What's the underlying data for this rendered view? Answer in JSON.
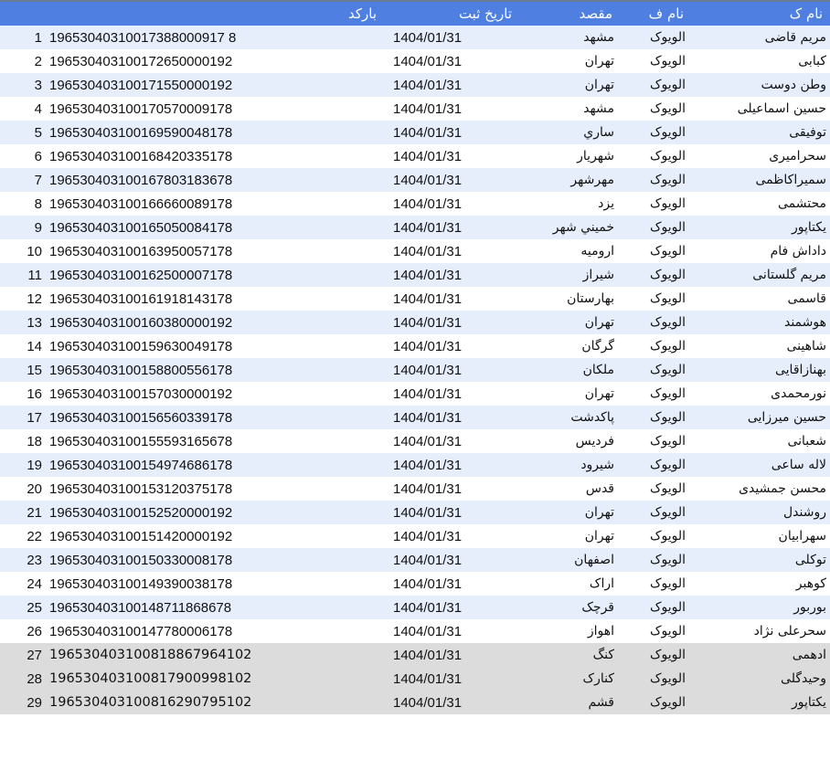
{
  "table": {
    "headers": {
      "name": "نام ک",
      "family": "نام ف",
      "dest": "مقصد",
      "date": "تاریخ ثبت",
      "barcode": "بارکد"
    },
    "rows": [
      {
        "idx": "1",
        "barcode": "19653040310017388000917 8",
        "date": "1404/01/31",
        "dest": "مشهد",
        "family": "الویوک",
        "name": "مریم قاضی"
      },
      {
        "idx": "2",
        "barcode": "196530403100172650000192",
        "date": "1404/01/31",
        "dest": "تهران",
        "family": "الویوک",
        "name": "کبابی"
      },
      {
        "idx": "3",
        "barcode": "196530403100171550000192",
        "date": "1404/01/31",
        "dest": "تهران",
        "family": "الویوک",
        "name": "وطن دوست"
      },
      {
        "idx": "4",
        "barcode": "196530403100170570009178",
        "date": "1404/01/31",
        "dest": "مشهد",
        "family": "الویوک",
        "name": "حسین اسماعیلی"
      },
      {
        "idx": "5",
        "barcode": "196530403100169590048178",
        "date": "1404/01/31",
        "dest": "ساري",
        "family": "الویوک",
        "name": "توفیقی"
      },
      {
        "idx": "6",
        "barcode": "196530403100168420335178",
        "date": "1404/01/31",
        "dest": "شهريار",
        "family": "الویوک",
        "name": "سحرامیری"
      },
      {
        "idx": "7",
        "barcode": "196530403100167803183678",
        "date": "1404/01/31",
        "dest": "مهرشهر",
        "family": "الویوک",
        "name": "سمیراکاظمی"
      },
      {
        "idx": "8",
        "barcode": "196530403100166660089178",
        "date": "1404/01/31",
        "dest": "یزد",
        "family": "الویوک",
        "name": "محتشمی"
      },
      {
        "idx": "9",
        "barcode": "196530403100165050084178",
        "date": "1404/01/31",
        "dest": "خميني شهر",
        "family": "الویوک",
        "name": "یکتاپور"
      },
      {
        "idx": "10",
        "barcode": "196530403100163950057178",
        "date": "1404/01/31",
        "dest": "ارومیه",
        "family": "الویوک",
        "name": "داداش فام"
      },
      {
        "idx": "11",
        "barcode": "196530403100162500007178",
        "date": "1404/01/31",
        "dest": "شیراز",
        "family": "الویوک",
        "name": "مریم گلستانی"
      },
      {
        "idx": "12",
        "barcode": "196530403100161918143178",
        "date": "1404/01/31",
        "dest": "بهارستان",
        "family": "الویوک",
        "name": "قاسمی"
      },
      {
        "idx": "13",
        "barcode": "196530403100160380000192",
        "date": "1404/01/31",
        "dest": "تهران",
        "family": "الویوک",
        "name": "هوشمند"
      },
      {
        "idx": "14",
        "barcode": "196530403100159630049178",
        "date": "1404/01/31",
        "dest": "گرگان",
        "family": "الویوک",
        "name": "شاهینی"
      },
      {
        "idx": "15",
        "barcode": "196530403100158800556178",
        "date": "1404/01/31",
        "dest": "ملکان",
        "family": "الویوک",
        "name": "بهنازاقایی"
      },
      {
        "idx": "16",
        "barcode": "196530403100157030000192",
        "date": "1404/01/31",
        "dest": "تهران",
        "family": "الویوک",
        "name": "نورمحمدی"
      },
      {
        "idx": "17",
        "barcode": "196530403100156560339178",
        "date": "1404/01/31",
        "dest": "پاکدشت",
        "family": "الویوک",
        "name": "حسین میرزایی"
      },
      {
        "idx": "18",
        "barcode": "196530403100155593165678",
        "date": "1404/01/31",
        "dest": "فرديس",
        "family": "الویوک",
        "name": "شعبانی"
      },
      {
        "idx": "19",
        "barcode": "196530403100154974686178",
        "date": "1404/01/31",
        "dest": "شیرود",
        "family": "الویوک",
        "name": "لاله ساعی"
      },
      {
        "idx": "20",
        "barcode": "196530403100153120375178",
        "date": "1404/01/31",
        "dest": "قدس",
        "family": "الویوک",
        "name": "محسن جمشیدی"
      },
      {
        "idx": "21",
        "barcode": "196530403100152520000192",
        "date": "1404/01/31",
        "dest": "تهران",
        "family": "الویوک",
        "name": "روشندل"
      },
      {
        "idx": "22",
        "barcode": "196530403100151420000192",
        "date": "1404/01/31",
        "dest": "تهران",
        "family": "الویوک",
        "name": "سهرابیان"
      },
      {
        "idx": "23",
        "barcode": "196530403100150330008178",
        "date": "1404/01/31",
        "dest": "اصفهان",
        "family": "الویوک",
        "name": "توکلی"
      },
      {
        "idx": "24",
        "barcode": "196530403100149390038178",
        "date": "1404/01/31",
        "dest": "اراک",
        "family": "الویوک",
        "name": "کوهبر"
      },
      {
        "idx": "25",
        "barcode": "196530403100148711868678",
        "date": "1404/01/31",
        "dest": "قرچک",
        "family": "الویوک",
        "name": "بوربور"
      },
      {
        "idx": "26",
        "barcode": "196530403100147780006178",
        "date": "1404/01/31",
        "dest": "اهواز",
        "family": "الویوک",
        "name": "سحرعلی نژاد"
      },
      {
        "idx": "27",
        "barcode": "196530403100818867964102",
        "date": "1404/01/31",
        "dest": "کنگ",
        "family": "الویوک",
        "name": "ادهمی"
      },
      {
        "idx": "28",
        "barcode": "196530403100817900998102",
        "date": "1404/01/31",
        "dest": "کنارک",
        "family": "الویوک",
        "name": "وحیدگلی"
      },
      {
        "idx": "29",
        "barcode": "196530403100816290795102",
        "date": "1404/01/31",
        "dest": "قشم",
        "family": "الویوک",
        "name": "یکتاپور"
      }
    ]
  },
  "colors": {
    "header_bg": "#4f7fe0",
    "stripe": "#e6eefb",
    "highlight": "#dcdcdc"
  }
}
